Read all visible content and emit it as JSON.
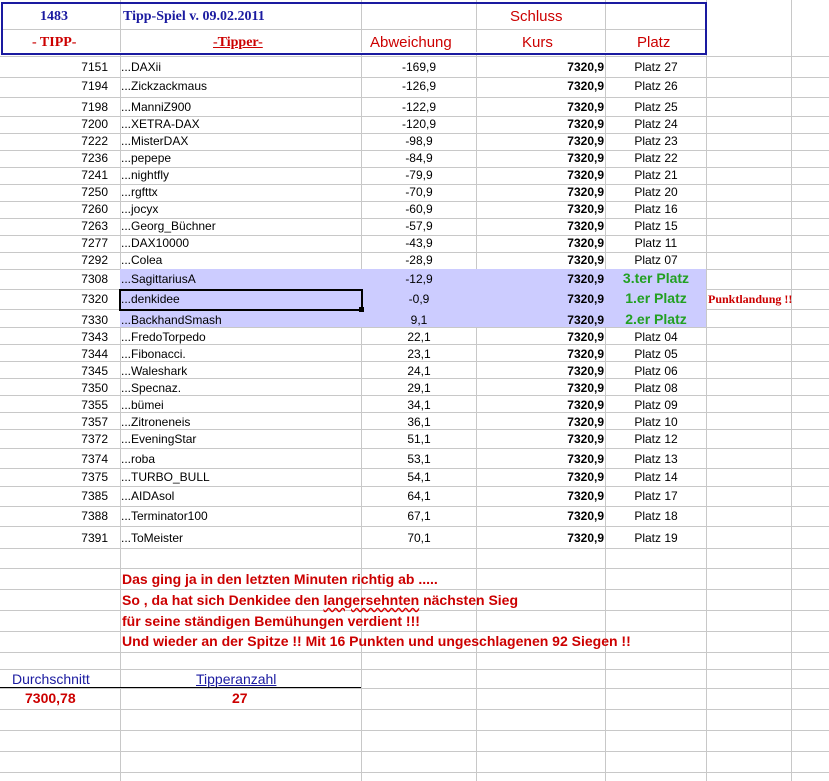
{
  "header": {
    "count": "1483",
    "title": "Tipp-Spiel v. 09.02.2011",
    "schluss": "Schluss",
    "col_tipp": "- TIPP-",
    "col_tipper": "-Tipper-",
    "col_abweichung": "Abweichung",
    "col_kurs": "Kurs",
    "col_platz": "Platz"
  },
  "colors": {
    "frame": "#1a1aa0",
    "header_red": "#cc0000",
    "highlight": "#ccccff",
    "podium_green": "#22a022"
  },
  "rows": [
    {
      "tipp": "7151",
      "name": "...DAXii",
      "abw": "-169,9",
      "kurs": "7320,9",
      "platz": "Platz 27"
    },
    {
      "tipp": "7194",
      "name": "...Zickzackmaus",
      "abw": "-126,9",
      "kurs": "7320,9",
      "platz": "Platz 26"
    },
    {
      "tipp": "7198",
      "name": "...ManniZ900",
      "abw": "-122,9",
      "kurs": "7320,9",
      "platz": "Platz 25"
    },
    {
      "tipp": "7200",
      "name": "...XETRA-DAX",
      "abw": "-120,9",
      "kurs": "7320,9",
      "platz": "Platz 24"
    },
    {
      "tipp": "7222",
      "name": "...MisterDAX",
      "abw": "-98,9",
      "kurs": "7320,9",
      "platz": "Platz 23"
    },
    {
      "tipp": "7236",
      "name": "...pepepe",
      "abw": "-84,9",
      "kurs": "7320,9",
      "platz": "Platz 22"
    },
    {
      "tipp": "7241",
      "name": "...nightfly",
      "abw": "-79,9",
      "kurs": "7320,9",
      "platz": "Platz 21"
    },
    {
      "tipp": "7250",
      "name": "...rgfttx",
      "abw": "-70,9",
      "kurs": "7320,9",
      "platz": "Platz 20"
    },
    {
      "tipp": "7260",
      "name": "...jocyx",
      "abw": "-60,9",
      "kurs": "7320,9",
      "platz": "Platz 16"
    },
    {
      "tipp": "7263",
      "name": "...Georg_Büchner",
      "abw": "-57,9",
      "kurs": "7320,9",
      "platz": "Platz 15"
    },
    {
      "tipp": "7277",
      "name": "...DAX10000",
      "abw": "-43,9",
      "kurs": "7320,9",
      "platz": "Platz 11"
    },
    {
      "tipp": "7292",
      "name": "...Colea",
      "abw": "-28,9",
      "kurs": "7320,9",
      "platz": "Platz 07"
    },
    {
      "tipp": "7308",
      "name": "...SagittariusA",
      "abw": "-12,9",
      "kurs": "7320,9",
      "platz": "3.ter Platz"
    },
    {
      "tipp": "7320",
      "name": "...denkidee",
      "abw": "-0,9",
      "kurs": "7320,9",
      "platz": "1.er Platz",
      "note": "Punktlandung !!"
    },
    {
      "tipp": "7330",
      "name": "...BackhandSmash",
      "abw": "9,1",
      "kurs": "7320,9",
      "platz": "2.er Platz"
    },
    {
      "tipp": "7343",
      "name": "...FredoTorpedo",
      "abw": "22,1",
      "kurs": "7320,9",
      "platz": "Platz 04"
    },
    {
      "tipp": "7344",
      "name": "...Fibonacci.",
      "abw": "23,1",
      "kurs": "7320,9",
      "platz": "Platz 05"
    },
    {
      "tipp": "7345",
      "name": "...Waleshark",
      "abw": "24,1",
      "kurs": "7320,9",
      "platz": "Platz 06"
    },
    {
      "tipp": "7350",
      "name": "...Specnaz.",
      "abw": "29,1",
      "kurs": "7320,9",
      "platz": "Platz 08"
    },
    {
      "tipp": "7355",
      "name": "...bümei",
      "abw": "34,1",
      "kurs": "7320,9",
      "platz": "Platz 09"
    },
    {
      "tipp": "7357",
      "name": "...Zitroneneis",
      "abw": "36,1",
      "kurs": "7320,9",
      "platz": "Platz 10"
    },
    {
      "tipp": "7372",
      "name": "...EveningStar",
      "abw": "51,1",
      "kurs": "7320,9",
      "platz": "Platz 12"
    },
    {
      "tipp": "7374",
      "name": "...roba",
      "abw": "53,1",
      "kurs": "7320,9",
      "platz": "Platz 13"
    },
    {
      "tipp": "7375",
      "name": "...TURBO_BULL",
      "abw": "54,1",
      "kurs": "7320,9",
      "platz": "Platz 14"
    },
    {
      "tipp": "7385",
      "name": "...AIDAsol",
      "abw": "64,1",
      "kurs": "7320,9",
      "platz": "Platz 17"
    },
    {
      "tipp": "7388",
      "name": "...Terminator100",
      "abw": "67,1",
      "kurs": "7320,9",
      "platz": "Platz 18"
    },
    {
      "tipp": "7391",
      "name": "...ToMeister",
      "abw": "70,1",
      "kurs": "7320,9",
      "platz": "Platz 19"
    }
  ],
  "messages": {
    "line1": "Das ging ja in den letzten Minuten richtig ab .....",
    "line2_a": "So , da hat sich Denkidee den ",
    "line2_b": "langersehnten",
    "line2_c": " nächsten Sieg",
    "line3": "für seine ständigen Bemühungen verdient !!!",
    "line4": "Und wieder an der Spitze !! Mit 16 Punkten und ungeschlagenen 92 Siegen !!"
  },
  "summary": {
    "avg_label": "Durchschnitt",
    "avg_value": "7300,78",
    "count_label": "Tipperanzahl",
    "count_value": "27"
  }
}
